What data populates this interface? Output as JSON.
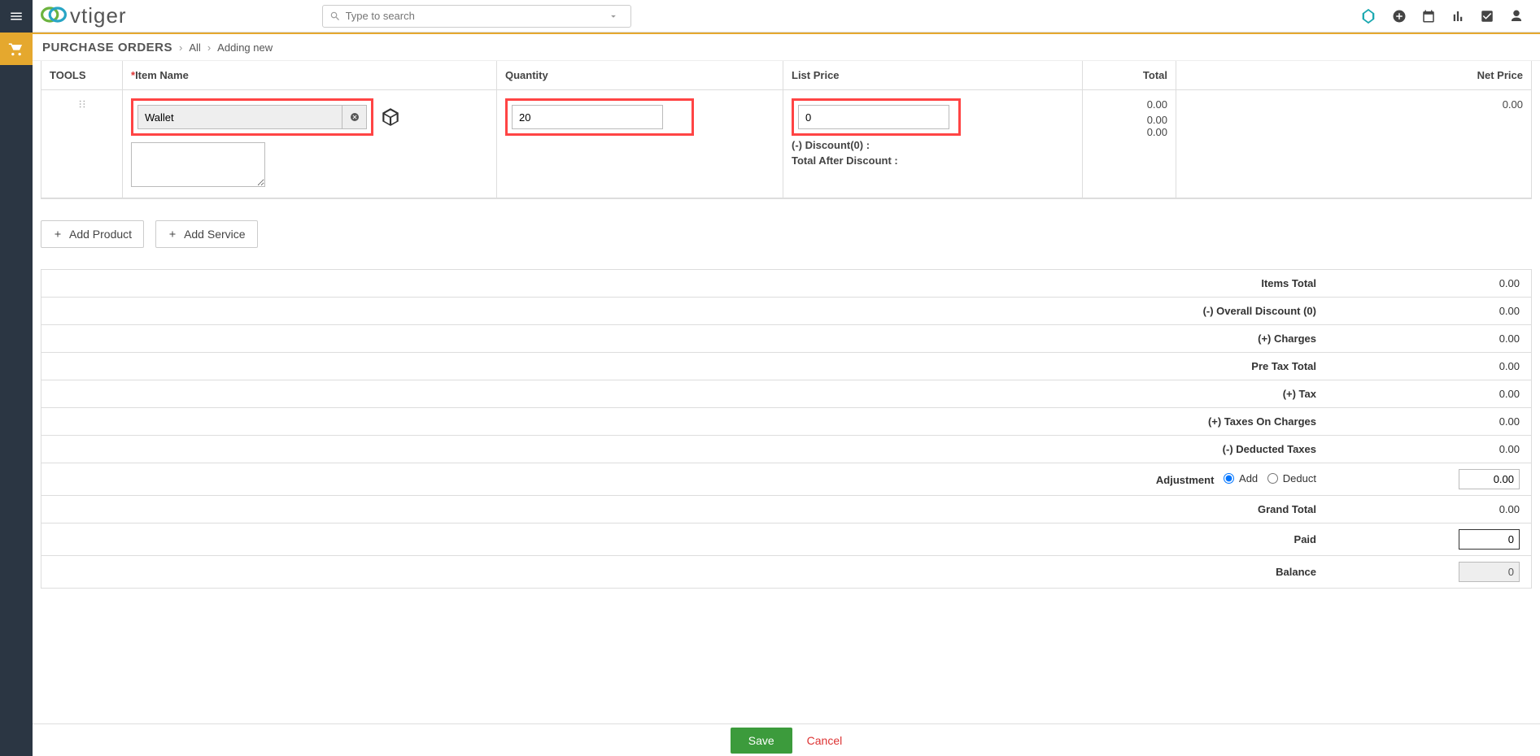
{
  "header": {
    "search_placeholder": "Type to search"
  },
  "breadcrumb": {
    "module": "PURCHASE ORDERS",
    "all": "All",
    "current": "Adding new"
  },
  "line_items": {
    "headers": {
      "tools": "TOOLS",
      "item_name": "Item Name",
      "quantity": "Quantity",
      "list_price": "List Price",
      "total": "Total",
      "net_price": "Net Price"
    },
    "row": {
      "item_name": "Wallet",
      "quantity": "20",
      "list_price": "0",
      "discount_label": "(-) Discount(0) :",
      "total_after_discount_label": "Total After Discount :",
      "total": "0.00",
      "total_discount": "0.00",
      "total_after_discount": "0.00",
      "net_price": "0.00"
    }
  },
  "buttons": {
    "add_product": "Add Product",
    "add_service": "Add Service",
    "save": "Save",
    "cancel": "Cancel"
  },
  "totals": {
    "items_total": {
      "label": "Items Total",
      "value": "0.00"
    },
    "overall_discount": {
      "label": "(-) Overall Discount (0)",
      "value": "0.00"
    },
    "charges": {
      "label": "(+) Charges",
      "value": "0.00"
    },
    "pre_tax_total": {
      "label": "Pre Tax Total",
      "value": "0.00"
    },
    "tax": {
      "label": "(+) Tax",
      "value": "0.00"
    },
    "taxes_on_charges": {
      "label": "(+) Taxes On Charges",
      "value": "0.00"
    },
    "deducted_taxes": {
      "label": "(-) Deducted Taxes",
      "value": "0.00"
    },
    "adjustment": {
      "label": "Adjustment",
      "add": "Add",
      "deduct": "Deduct",
      "value": "0.00"
    },
    "grand_total": {
      "label": "Grand Total",
      "value": "0.00"
    },
    "paid": {
      "label": "Paid",
      "value": "0"
    },
    "balance": {
      "label": "Balance",
      "value": "0"
    }
  }
}
